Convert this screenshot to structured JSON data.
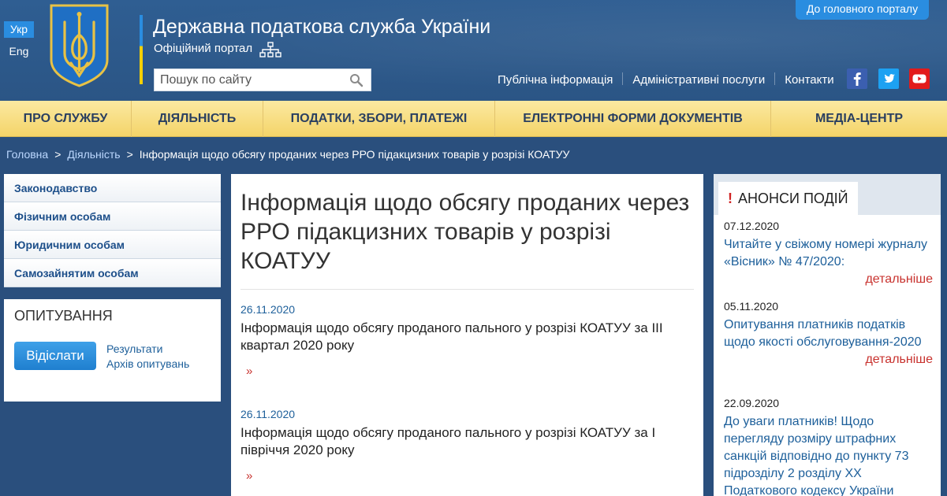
{
  "header": {
    "languages": {
      "active": "Укр",
      "other": "Eng"
    },
    "title": "Державна податкова служба України",
    "subtitle": "Офіційний портал",
    "search_placeholder": "Пошук по сайту",
    "portal_button": "До головного порталу",
    "top_links": [
      "Публічна інформація",
      "Адміністративні послуги",
      "Контакти"
    ],
    "social": [
      "facebook-icon",
      "twitter-icon",
      "youtube-icon"
    ],
    "colors": {
      "accent": "#2a8de0",
      "header_bg": "#2f5e92",
      "nav_bg": "#f4d469",
      "link": "#1d5f9a",
      "more": "#c8322e"
    }
  },
  "nav": {
    "items": [
      "ПРО СЛУЖБУ",
      "ДІЯЛЬНІСТЬ",
      "ПОДАТКИ, ЗБОРИ, ПЛАТЕЖІ",
      "ЕЛЕКТРОННІ ФОРМИ ДОКУМЕНТІВ",
      "МЕДІА-ЦЕНТР"
    ]
  },
  "breadcrumb": {
    "home": "Головна",
    "section": "Діяльність",
    "separator": ">",
    "current": "Інформація щодо обсягу проданих через РРО підакцизних товарів у розрізі КОАТУУ"
  },
  "sidebar": {
    "items": [
      "Законодавство",
      "Фізичним особам",
      "Юридичним особам",
      "Самозайнятим особам"
    ],
    "poll": {
      "title": "ОПИТУВАННЯ",
      "submit": "Відіслати",
      "results": "Результати",
      "archive": "Архів опитувань"
    }
  },
  "main": {
    "title": "Інформація щодо обсягу проданих через РРО підакцизних товарів у розрізі КОАТУУ",
    "more_symbol": "»",
    "news": [
      {
        "date": "26.11.2020",
        "title": "Інформація щодо обсягу проданого пального у розрізі КОАТУУ за ІІІ квартал 2020 року"
      },
      {
        "date": "26.11.2020",
        "title": "Інформація щодо обсягу проданого пального у розрізі КОАТУУ за І півріччя 2020 року"
      }
    ]
  },
  "announcements": {
    "title": "АНОНСИ ПОДІЙ",
    "marker": "!",
    "more_label": "детальніше",
    "items": [
      {
        "date": "07.12.2020",
        "title": "Читайте у свіжому номері журналу «Вісник» № 47/2020:"
      },
      {
        "date": "05.11.2020",
        "title": "Опитування платників податків щодо якості обслуговування-2020"
      },
      {
        "date": "22.09.2020",
        "title": "До уваги платників! Щодо перегляду розміру штрафних санкцій відповідно до пункту 73 підрозділу 2 розділу ХХ Податкового кодексу України"
      }
    ]
  }
}
